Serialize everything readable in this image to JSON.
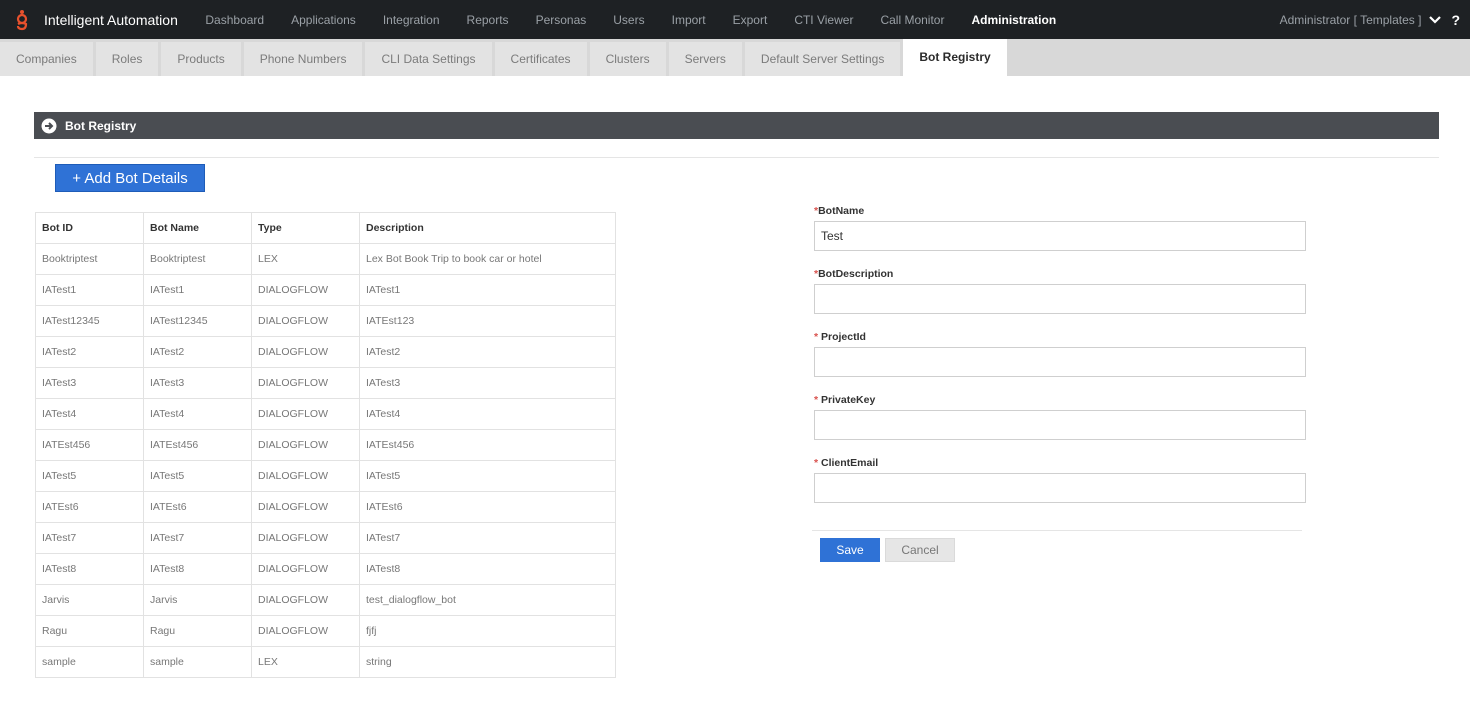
{
  "app": {
    "title": "Intelligent Automation",
    "nav": [
      "Dashboard",
      "Applications",
      "Integration",
      "Reports",
      "Personas",
      "Users",
      "Import",
      "Export",
      "CTI Viewer",
      "Call Monitor",
      "Administration"
    ],
    "active_nav": "Administration",
    "user": "Administrator [ Templates ]",
    "help": "?"
  },
  "subtabs": [
    "Companies",
    "Roles",
    "Products",
    "Phone Numbers",
    "CLI Data Settings",
    "Certificates",
    "Clusters",
    "Servers",
    "Default Server Settings",
    "Bot Registry"
  ],
  "active_subtab": "Bot Registry",
  "panel": {
    "title": "Bot Registry",
    "add_button": "+ Add Bot Details"
  },
  "table": {
    "headers": [
      "Bot ID",
      "Bot Name",
      "Type",
      "Description"
    ],
    "rows": [
      [
        "Booktriptest",
        "Booktriptest",
        "LEX",
        "Lex Bot Book Trip to book car or hotel"
      ],
      [
        "IATest1",
        "IATest1",
        "DIALOGFLOW",
        "IATest1"
      ],
      [
        "IATest12345",
        "IATest12345",
        "DIALOGFLOW",
        "IATEst123"
      ],
      [
        "IATest2",
        "IATest2",
        "DIALOGFLOW",
        "IATest2"
      ],
      [
        "IATest3",
        "IATest3",
        "DIALOGFLOW",
        "IATest3"
      ],
      [
        "IATest4",
        "IATest4",
        "DIALOGFLOW",
        "IATest4"
      ],
      [
        "IATEst456",
        "IATEst456",
        "DIALOGFLOW",
        "IATEst456"
      ],
      [
        "IATest5",
        "IATest5",
        "DIALOGFLOW",
        "IATest5"
      ],
      [
        "IATEst6",
        "IATEst6",
        "DIALOGFLOW",
        "IATEst6"
      ],
      [
        "IATest7",
        "IATest7",
        "DIALOGFLOW",
        "IATest7"
      ],
      [
        "IATest8",
        "IATest8",
        "DIALOGFLOW",
        "IATest8"
      ],
      [
        "Jarvis",
        "Jarvis",
        "DIALOGFLOW",
        "test_dialogflow_bot"
      ],
      [
        "Ragu",
        "Ragu",
        "DIALOGFLOW",
        "fjfj"
      ],
      [
        "sample",
        "sample",
        "LEX",
        "string"
      ]
    ]
  },
  "form": {
    "fields": [
      {
        "required_mark": "*",
        "label": "BotName",
        "value": "Test"
      },
      {
        "required_mark": "*",
        "label": "BotDescription",
        "value": ""
      },
      {
        "required_mark": "* ",
        "label": "ProjectId",
        "value": ""
      },
      {
        "required_mark": "* ",
        "label": "PrivateKey",
        "value": ""
      },
      {
        "required_mark": "* ",
        "label": "ClientEmail",
        "value": ""
      }
    ],
    "save_label": "Save",
    "cancel_label": "Cancel"
  },
  "colors": {
    "topbar": "#1e2124",
    "accent_blue": "#2f72d6",
    "logo": "#e8512d",
    "panel_header": "#4a4d52",
    "required": "#d9534f"
  },
  "icons": {
    "logo": "genesys-logo-icon",
    "panel": "arrow-circle-right-icon",
    "user_menu": "chevron-down-icon"
  }
}
